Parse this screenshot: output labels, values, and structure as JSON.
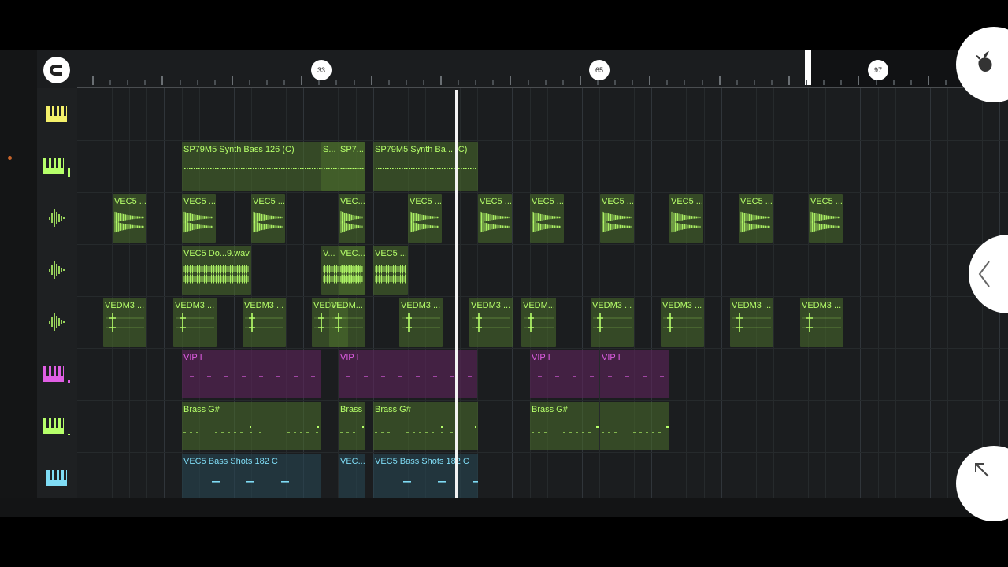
{
  "ruler": {
    "markers": [
      {
        "label": "33"
      },
      {
        "label": "65"
      },
      {
        "label": "97"
      }
    ]
  },
  "icons": {
    "magnet": "magnet-icon",
    "logo": "fl-studio-fruit-icon",
    "collapse": "chevron-left-icon",
    "expand": "expand-arrow-icon"
  },
  "colors": {
    "green": "#b6ff6a",
    "purple": "#e05ee4",
    "teal": "#7fdcf5",
    "yellow": "#f4f06a"
  },
  "tracks": [
    {
      "icon": "piano-keys-icon",
      "color": "#f4f06a"
    },
    {
      "icon": "piano-keys-icon",
      "color": "#b6ff6a"
    },
    {
      "icon": "waveform-icon",
      "color": "#b6ff6a"
    },
    {
      "icon": "waveform-icon",
      "color": "#b6ff6a"
    },
    {
      "icon": "waveform-icon",
      "color": "#b6ff6a"
    },
    {
      "icon": "piano-keys-icon",
      "color": "#e05ee4"
    },
    {
      "icon": "piano-keys-icon",
      "color": "#b6ff6a"
    },
    {
      "icon": "piano-keys-icon",
      "color": "#7fdcf5"
    }
  ],
  "clips": {
    "t1": [
      "SP79M5 Synth Bass 126 (C)",
      "S...",
      "SP7...",
      "SP79M5 Synth Ba... (C)"
    ],
    "t2": [
      "VEC5 ...",
      "VEC5 ...",
      "VEC5 ...",
      "VEC...",
      "VEC5 ...",
      "VEC5 ...",
      "VEC5 ...",
      "VEC5 ...",
      "VEC5 ...",
      "VEC5 ...",
      "VEC5 ..."
    ],
    "t3": [
      "VEC5 Do...9.wav",
      "V...",
      "VEC...",
      "VEC5 ..."
    ],
    "t4": [
      "VEDM3 ...",
      "VEDM3 ...",
      "VEDM3 ...",
      "VEDM...",
      "VEDM...",
      "VEDM3 ...",
      "VEDM3 ...",
      "VEDM...",
      "VEDM3 ...",
      "VEDM3 ...",
      "VEDM3 ...",
      "VEDM3 ..."
    ],
    "t5": [
      "VIP I",
      "VIP I",
      "VIP I",
      "VIP I"
    ],
    "t6": [
      "Brass G#",
      "Brass G#",
      "Brass G#",
      "Brass G#"
    ],
    "t7": [
      "VEC5 Bass Shots 182 C",
      "VEC...",
      "VEC5 Bass Shots 182 C"
    ]
  }
}
